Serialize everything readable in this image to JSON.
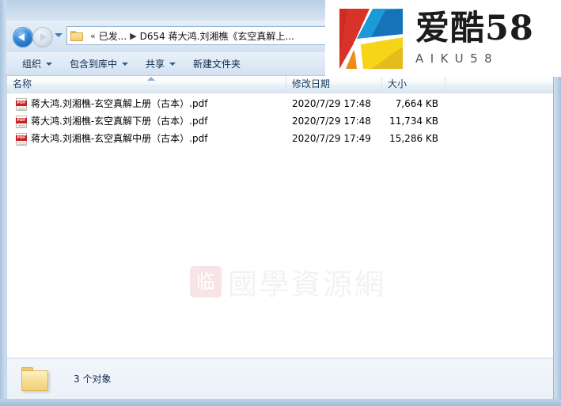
{
  "window": {
    "nav": {
      "back_icon": "back-arrow-icon",
      "forward_icon": "forward-arrow-icon",
      "recent_icon": "chevron-down-icon",
      "address_dropdown_icon": "chevron-down-icon",
      "breadcrumb": {
        "folder_icon": "folder-icon",
        "overflow": "«",
        "parent": "已发...",
        "separator": "▶",
        "current": "D654 蒋大鸿.刘湘樵《玄空真解上..."
      }
    },
    "toolbar": {
      "items": [
        {
          "label": "组织",
          "has_caret": true
        },
        {
          "label": "包含到库中",
          "has_caret": true
        },
        {
          "label": "共享",
          "has_caret": true
        },
        {
          "label": "新建文件夹",
          "has_caret": false
        }
      ]
    },
    "filelist": {
      "columns": [
        {
          "key": "name",
          "label": "名称"
        },
        {
          "key": "date",
          "label": "修改日期"
        },
        {
          "key": "size",
          "label": "大小"
        }
      ],
      "sort_indicator": "sort-ascending-icon",
      "rows": [
        {
          "icon": "pdf-file-icon",
          "icon_label": "PDF",
          "name": "蒋大鸿.刘湘樵-玄空真解上册（古本）.pdf",
          "date": "2020/7/29 17:48",
          "size": "7,664 KB"
        },
        {
          "icon": "pdf-file-icon",
          "icon_label": "PDF",
          "name": "蒋大鸿.刘湘樵-玄空真解下册（古本）.pdf",
          "date": "2020/7/29 17:48",
          "size": "11,734 KB"
        },
        {
          "icon": "pdf-file-icon",
          "icon_label": "PDF",
          "name": "蒋大鸿.刘湘樵-玄空真解中册（古本）.pdf",
          "date": "2020/7/29 17:49",
          "size": "15,286 KB"
        }
      ]
    },
    "watermark": {
      "logo_glyph": "临",
      "text": "國學資源網"
    },
    "statusbar": {
      "folder_icon": "folder-icon",
      "text": "3 个对象"
    }
  },
  "logo_overlay": {
    "mark_name": "aiku58-k-logo-icon",
    "cn_title": "爱酷58",
    "en_title": "AIKU58",
    "colors": {
      "red": "#d93229",
      "blue": "#1a9ad8",
      "blue_dark": "#1573b8",
      "yellow": "#f6d417",
      "yellow_dark": "#e6bb1c",
      "orange": "#f08a1a",
      "text_dark": "#1c1c1c"
    }
  }
}
